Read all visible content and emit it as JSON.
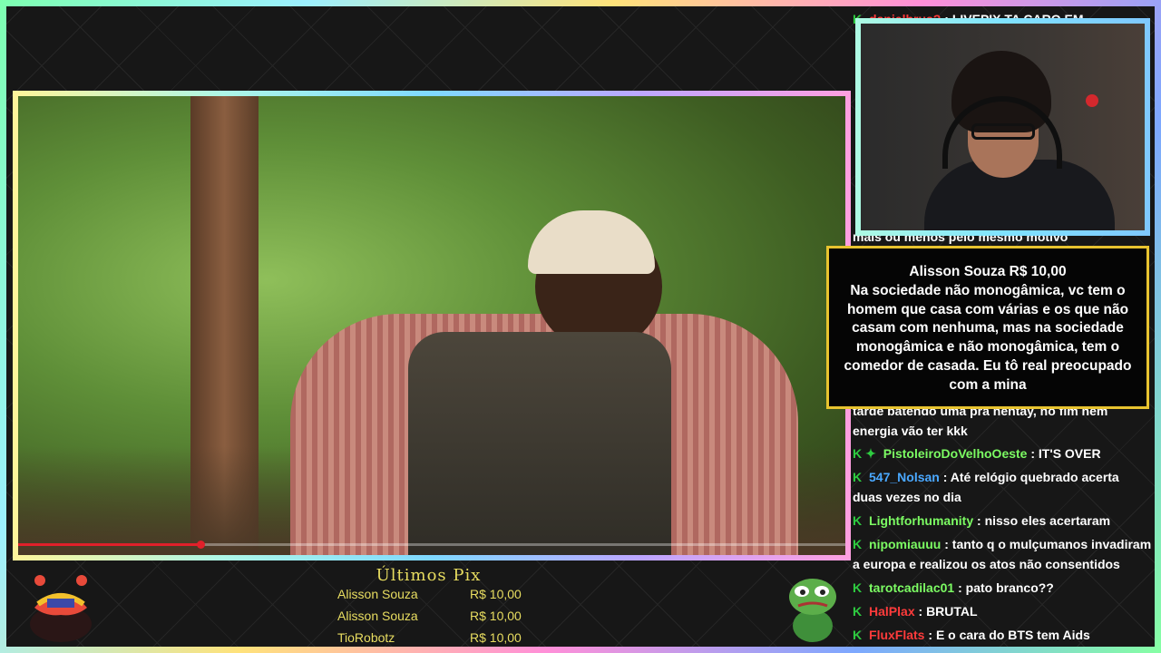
{
  "donation": {
    "donor_line": "Alisson Souza R$ 10,00",
    "message": "Na sociedade não monogâmica, vc tem o homem que casa com várias e os que não casam com nenhuma, mas na sociedade monogâmica e não monogâmica, tem o comedor de casada. Eu tô real preocupado com a mina"
  },
  "chat": {
    "top_partial": {
      "user": "danielbrus?",
      "text": "LIVEPIX TA CARO EM"
    },
    "partial_lines": [
      "mais ou menos pelo mesmo motivo",
      "tarde batendo uma pra hentay, no fim nem",
      "energia vão ter kkk"
    ],
    "messages": [
      {
        "user": "PistoleiroDoVelhoOeste",
        "color": "#7CFC63",
        "text": "IT'S OVER"
      },
      {
        "user": "547_Nolsan",
        "color": "#4aa8ff",
        "text": "Até relógio quebrado acerta duas vezes no dia"
      },
      {
        "user": "Lightforhumanity",
        "color": "#7CFC63",
        "text": "nisso eles acertaram"
      },
      {
        "user": "nipomiauuu",
        "color": "#7CFC63",
        "text": "tanto q o mulçumanos invadiram a europa e realizou os atos não consentidos"
      },
      {
        "user": "tarotcadilac01",
        "color": "#7CFC63",
        "text": "pato branco??"
      },
      {
        "user": "HalPlax",
        "color": "#ff3b3b",
        "text": "BRUTAL"
      },
      {
        "user": "FluxFlats",
        "color": "#ff3b3b",
        "text": "E o cara do BTS tem Aids"
      }
    ]
  },
  "pix": {
    "title": "Últimos Pix",
    "entries": [
      {
        "name": "Alisson Souza",
        "amount": "R$ 10,00"
      },
      {
        "name": "Alisson Souza",
        "amount": "R$ 10,00"
      },
      {
        "name": "TioRobotz",
        "amount": "R$ 10,00"
      }
    ]
  },
  "video": {
    "progress": 0.22
  },
  "colors": {
    "accent_yellow": "#e8dd60",
    "mod_green": "#2ecc40",
    "popup_border": "#e8c32f"
  }
}
